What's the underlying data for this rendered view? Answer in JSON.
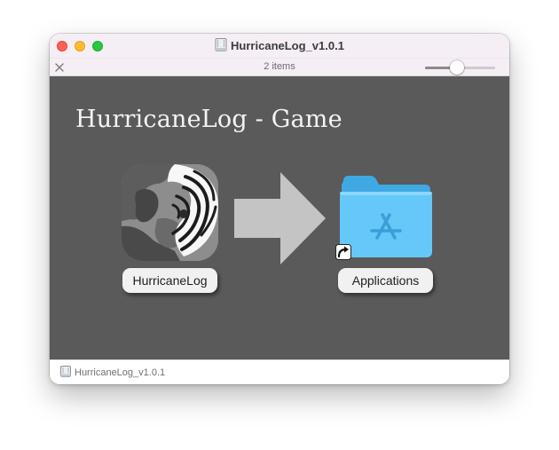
{
  "window": {
    "title": "HurricaneLog_v1.0.1",
    "title_icon": "disk-image-icon"
  },
  "toolbar": {
    "item_count": "2 items",
    "icon_size_slider_value": 0.45,
    "close_icon": "close-x-icon"
  },
  "content": {
    "heading": "HurricaneLog - Game",
    "background_color": "#5a5a5a",
    "items": [
      {
        "label": "HurricaneLog",
        "icon": "app-icon"
      },
      {
        "label": "Applications",
        "icon": "applications-folder-icon",
        "alias": true
      }
    ],
    "arrow_icon": "right-arrow-icon"
  },
  "pathbar": {
    "label": "HurricaneLog_v1.0.1",
    "icon": "disk-image-icon"
  },
  "colors": {
    "traffic_close": "#fe5f57",
    "traffic_minimize": "#febc2e",
    "traffic_zoom": "#28c840",
    "folder_blue": "#5ec4f5"
  }
}
